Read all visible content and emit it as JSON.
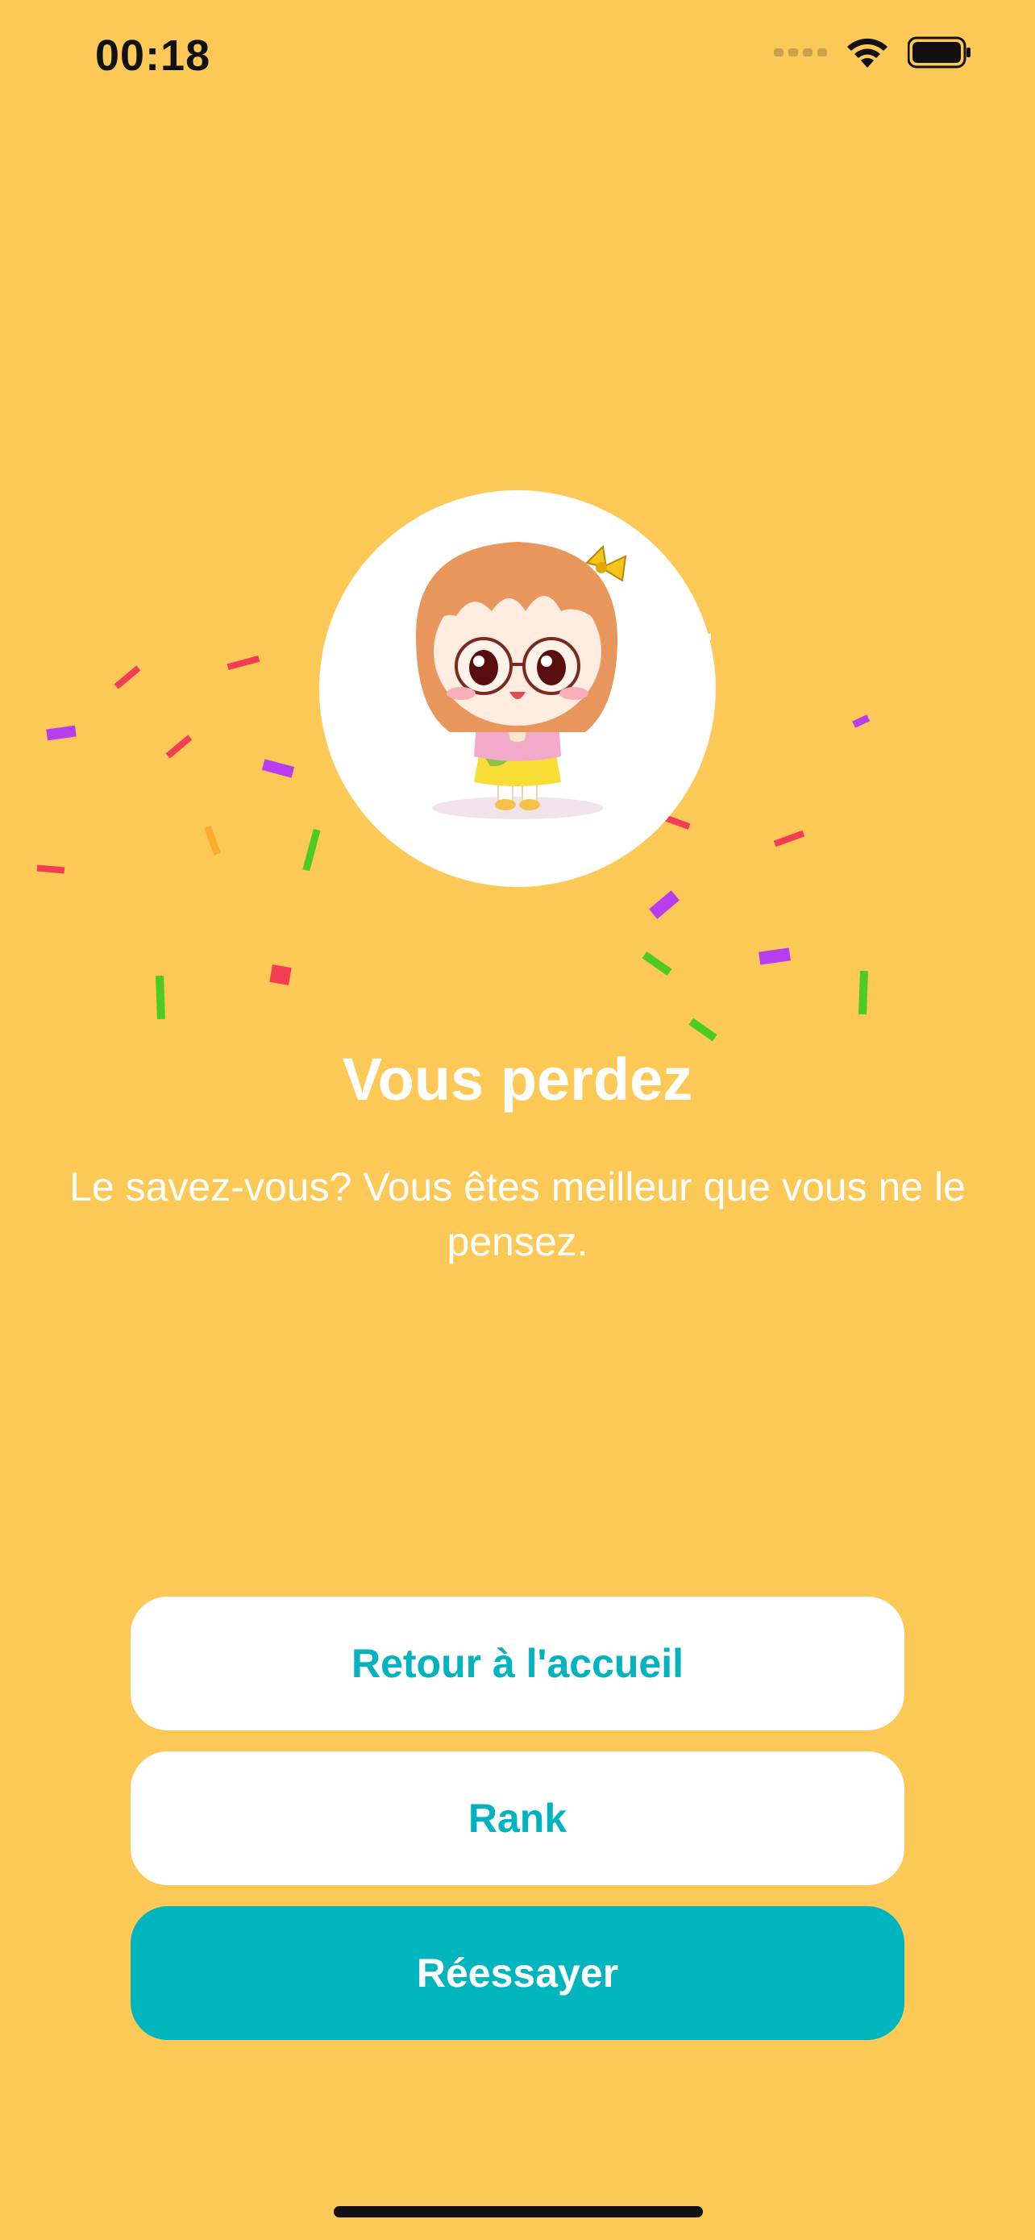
{
  "status_bar": {
    "time": "00:18"
  },
  "result": {
    "title": "Vous perdez",
    "message": "Le savez-vous? Vous êtes meilleur que vous ne le pensez."
  },
  "buttons": {
    "home_label": "Retour à l'accueil",
    "rank_label": "Rank",
    "retry_label": "Réessayer"
  },
  "colors": {
    "background": "#FDC956",
    "accent": "#00B5BE",
    "card": "#FFFFFF"
  },
  "icons": {
    "avatar": "girl-character-illustration",
    "wifi": "wifi-icon",
    "battery": "battery-icon"
  }
}
